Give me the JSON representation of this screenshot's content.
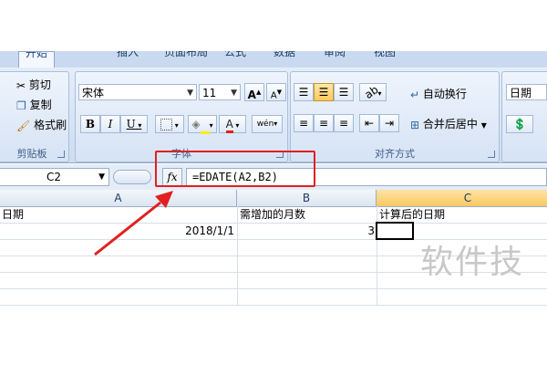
{
  "ribbon": {
    "tabs": [
      "开始",
      "插入",
      "页面布局",
      "公式",
      "数据",
      "审阅",
      "视图"
    ],
    "clipboard": {
      "cut": "剪切",
      "copy": "复制",
      "format_painter": "格式刷",
      "group_label": "剪贴板"
    },
    "font": {
      "name": "宋体",
      "size": "11",
      "bold": "B",
      "italic": "I",
      "underline": "U",
      "grow": "A",
      "shrink": "A",
      "color_letter": "A",
      "phonetic": "wén",
      "group_label": "字体"
    },
    "alignment": {
      "wrap_text": "自动换行",
      "merge_center": "合并后居中",
      "group_label": "对齐方式"
    },
    "number": {
      "format": "日期"
    }
  },
  "formula_bar": {
    "name_box": "C2",
    "fx": "fx",
    "formula": "=EDATE(A2,B2)"
  },
  "sheet": {
    "columns": [
      "A",
      "B",
      "C"
    ],
    "rows": [
      {
        "a": "日期",
        "b": "需增加的月数",
        "c": "计算后的日期"
      },
      {
        "a": "2018/1/1",
        "b": "3",
        "c": ""
      }
    ]
  },
  "watermark": "软件技",
  "colors": {
    "annotation": "#e02020",
    "selected_header": "#f8c85f"
  }
}
